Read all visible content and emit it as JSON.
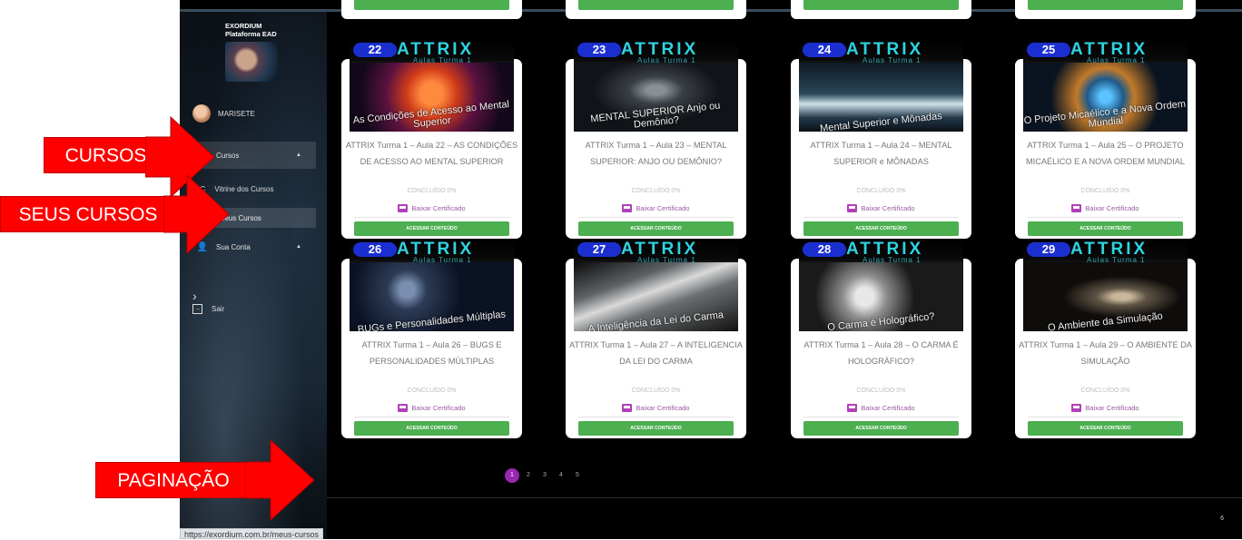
{
  "sidebar": {
    "brand_line1": "EXORDIUM",
    "brand_line2": "Plataforma EAD",
    "user_name": "MARISETE",
    "cursos_label": "Cursos",
    "vitrine_prefix": "LC",
    "vitrine_label": "Vitrine dos Cursos",
    "seus_cursos_label": "Seus Cursos",
    "sua_conta_label": "Sua Conta",
    "sair_label": "Sair"
  },
  "cards": [
    {
      "number": "22",
      "brand": "ATTRIX",
      "subtitle": "Aulas Turma 1",
      "art_caption": "As Condições de Acesso ao Mental Superior",
      "title": "ATTRIX Turma 1 – Aula 22 – AS CONDIÇÕES DE ACESSO AO MENTAL SUPERIOR",
      "status": "CONCLUÍDO 0%",
      "cert": "Baixar Certificado",
      "button": "ACESSAR CONTEÚDO"
    },
    {
      "number": "23",
      "brand": "ATTRIX",
      "subtitle": "Aulas Turma 1",
      "art_caption": "MENTAL SUPERIOR Anjo ou Demônio?",
      "title": "ATTRIX Turma 1 – Aula 23 – MENTAL SUPERIOR: ANJO OU DEMÔNIO?",
      "status": "CONCLUÍDO 0%",
      "cert": "Baixar Certificado",
      "button": "ACESSAR CONTEÚDO"
    },
    {
      "number": "24",
      "brand": "ATTRIX",
      "subtitle": "Aulas Turma 1",
      "art_caption": "Mental Superior e Mônadas",
      "title": "ATTRIX Turma 1 – Aula 24 – MENTAL SUPERIOR e MÔNADAS",
      "status": "CONCLUÍDO 0%",
      "cert": "Baixar Certificado",
      "button": "ACESSAR CONTEÚDO"
    },
    {
      "number": "25",
      "brand": "ATTRIX",
      "subtitle": "Aulas Turma 1",
      "art_caption": "O Projeto Micaélico e a Nova Ordem Mundial",
      "title": "ATTRIX Turma 1 – Aula 25 – O PROJETO MICAÉLICO E A NOVA ORDEM MUNDIAL",
      "status": "CONCLUÍDO 0%",
      "cert": "Baixar Certificado",
      "button": "ACESSAR CONTEÚDO"
    },
    {
      "number": "26",
      "brand": "ATTRIX",
      "subtitle": "Aulas Turma 1",
      "art_caption": "BUGs e Personalidades Múltiplas",
      "title": "ATTRIX Turma 1 – Aula 26 – BUGS E PERSONALIDADES MÚLTIPLAS",
      "status": "CONCLUÍDO 0%",
      "cert": "Baixar Certificado",
      "button": "ACESSAR CONTEÚDO"
    },
    {
      "number": "27",
      "brand": "ATTRIX",
      "subtitle": "Aulas Turma 1",
      "art_caption": "A Inteligência da Lei do Carma",
      "title": "ATTRIX Turma 1 – Aula 27 – A INTELIGENCIA DA LEI DO CARMA",
      "status": "CONCLUÍDO 0%",
      "cert": "Baixar Certificado",
      "button": "ACESSAR CONTEÚDO"
    },
    {
      "number": "28",
      "brand": "ATTRIX",
      "subtitle": "Aulas Turma 1",
      "art_caption": "O Carma é Holográfico?",
      "title": "ATTRIX Turma 1 – Aula 28 – O CARMA É HOLOGRÁFICO?",
      "status": "CONCLUÍDO 0%",
      "cert": "Baixar Certificado",
      "button": "ACESSAR CONTEÚDO"
    },
    {
      "number": "29",
      "brand": "ATTRIX",
      "subtitle": "Aulas Turma 1",
      "art_caption": "O Ambiente da Simulação",
      "title": "ATTRIX Turma 1 – Aula 29 – O AMBIENTE DA SIMULAÇÃO",
      "status": "CONCLUÍDO 0%",
      "cert": "Baixar Certificado",
      "button": "ACESSAR CONTEÚDO"
    }
  ],
  "pagination": {
    "pages": [
      "1",
      "2",
      "3",
      "4",
      "5"
    ],
    "current": "1"
  },
  "footer": {
    "number": "6"
  },
  "status_url": "https://exordium.com.br/meus-cursos",
  "callouts": {
    "cursos": "CURSOS",
    "seus_cursos": "SEUS CURSOS",
    "paginacao": "PAGINAÇÃO"
  },
  "colors": {
    "accent_green": "#4caf50",
    "page_active": "#9c27b0",
    "callout_red": "#ff0000",
    "cert_purple": "#9c5aa3"
  }
}
